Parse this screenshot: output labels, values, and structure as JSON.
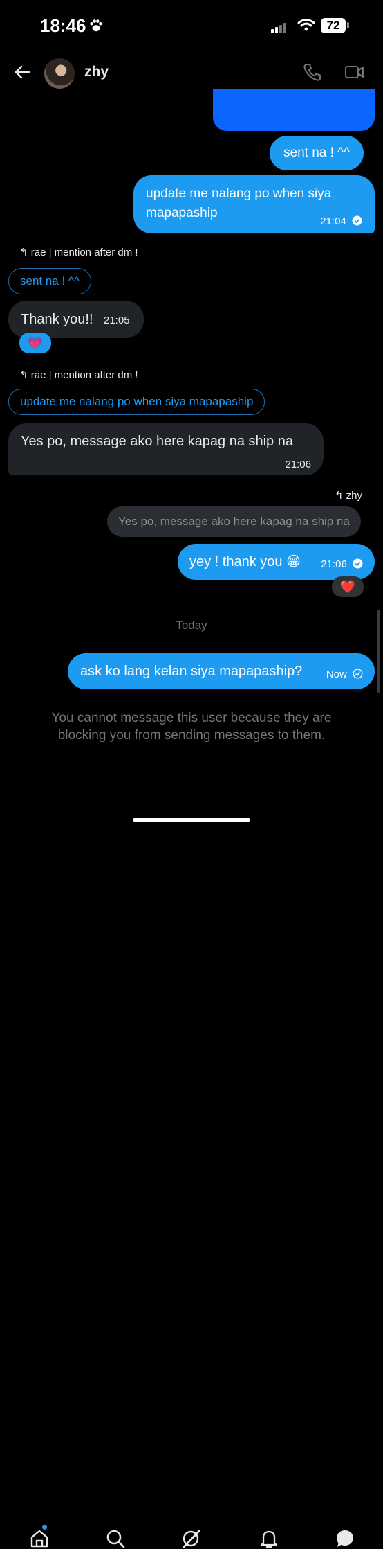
{
  "status_bar": {
    "time": "18:46",
    "battery": "72"
  },
  "header": {
    "username": "zhy"
  },
  "messages": {
    "m1": {
      "text": "sent na ! ^^"
    },
    "m2": {
      "text": "update me nalang po when siya mapapaship",
      "time": "21:04"
    },
    "r1": {
      "reply_to": "rae | mention after dm !",
      "quote": "sent na ! ^^"
    },
    "m3": {
      "text": "Thank you!!",
      "time": "21:05",
      "reaction": "💗"
    },
    "r2": {
      "reply_to": "rae | mention after dm !",
      "quote": "update me nalang po when siya mapapaship"
    },
    "m4": {
      "text": "Yes po, message ako here kapag na ship na",
      "time": "21:06"
    },
    "r3": {
      "reply_to": "zhy",
      "quote": "Yes po, message ako here kapag na ship na"
    },
    "m5": {
      "text": "yey ! thank you 😁",
      "time": "21:06",
      "reaction": "❤️"
    },
    "divider": "Today",
    "m6": {
      "text": "ask ko lang kelan siya mapapaship?",
      "time": "Now"
    }
  },
  "footer": {
    "blocked_notice": "You cannot message this user because they are blocking you from sending messages to them."
  },
  "colors": {
    "accent": "#1d9bf0",
    "incoming_bubble": "#202327",
    "muted_text": "#71767b"
  },
  "icons": [
    "paw-icon",
    "signal-icon",
    "wifi-icon",
    "back-arrow-icon",
    "phone-icon",
    "video-icon",
    "reply-icon",
    "check-icon",
    "home-icon",
    "search-icon",
    "grok-icon",
    "bell-icon",
    "messages-icon"
  ]
}
